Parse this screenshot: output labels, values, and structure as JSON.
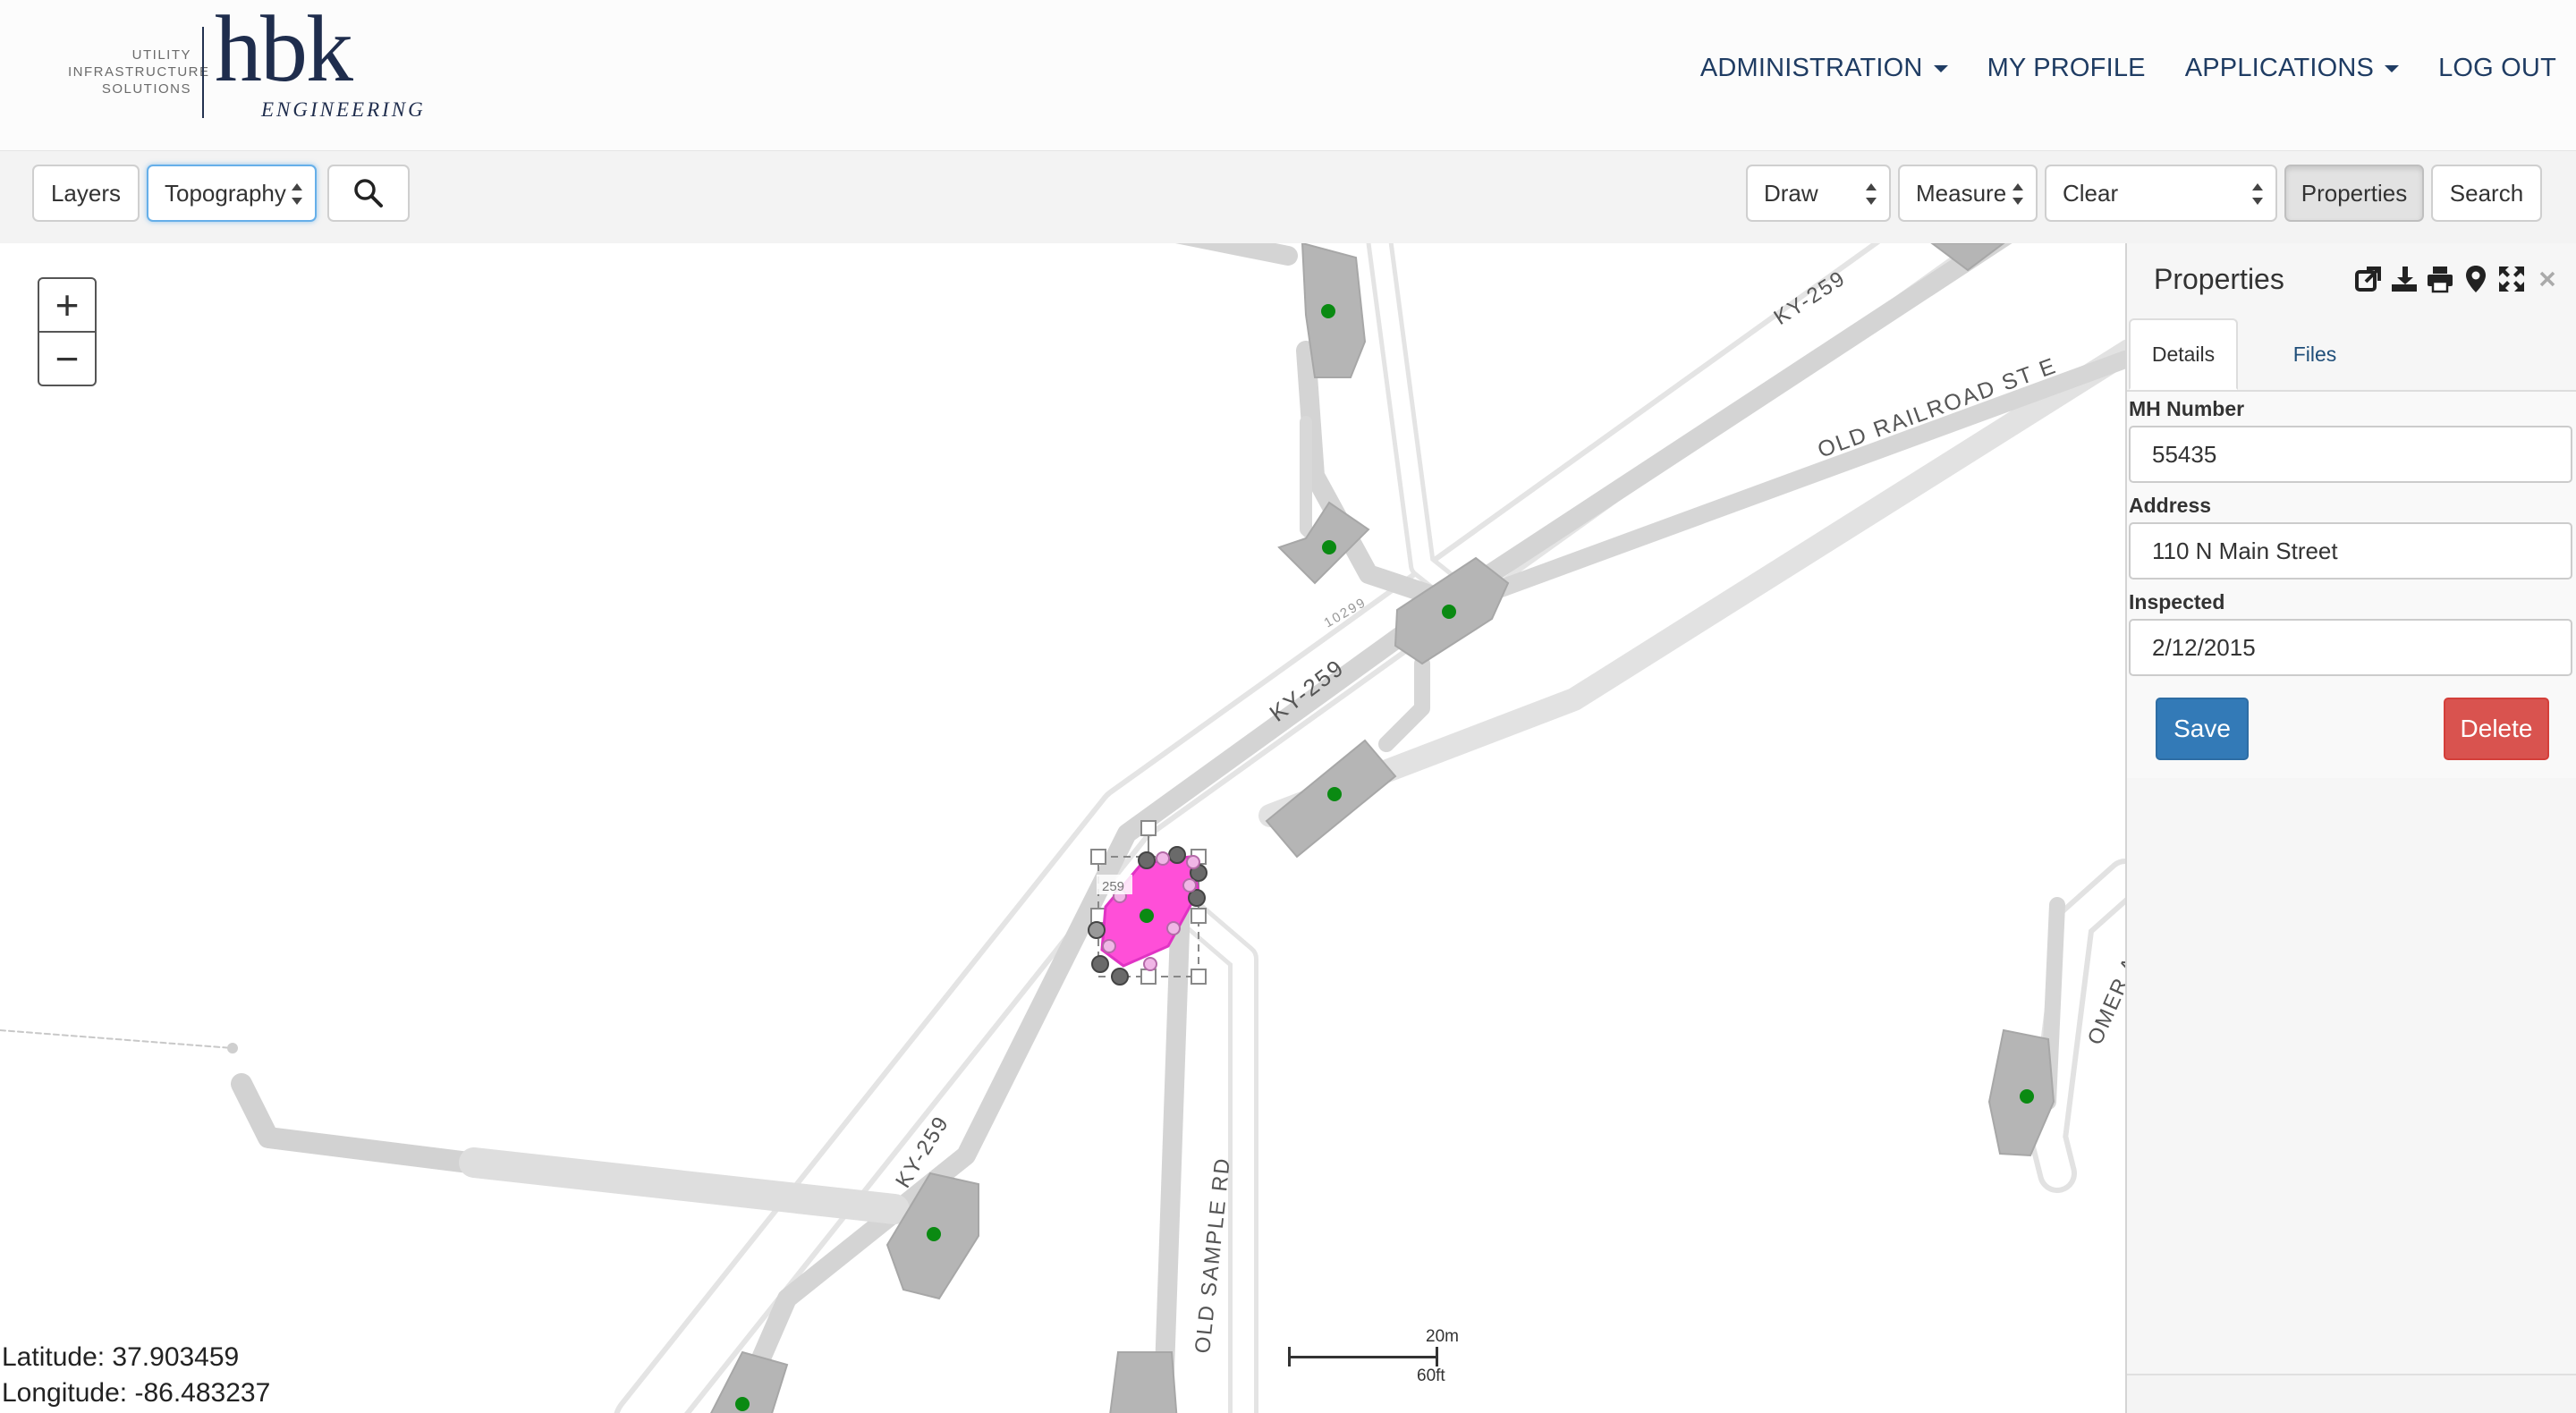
{
  "brand": {
    "tagline": [
      "UTILITY",
      "INFRASTRUCTURE",
      "SOLUTIONS"
    ],
    "name": "hbk",
    "subtitle": "ENGINEERING",
    "color": "#1f2d4d"
  },
  "nav": {
    "items": [
      {
        "label": "ADMINISTRATION",
        "dropdown": true
      },
      {
        "label": "MY PROFILE",
        "dropdown": false
      },
      {
        "label": "APPLICATIONS",
        "dropdown": true
      },
      {
        "label": "LOG OUT",
        "dropdown": false
      }
    ]
  },
  "toolbar": {
    "layers_label": "Layers",
    "basemap_value": "Topography",
    "search_icon": "search-icon",
    "draw_value": "Draw",
    "measure_value": "Measure",
    "clear_value": "Clear",
    "properties_label": "Properties",
    "search_label": "Search"
  },
  "map": {
    "zoom_in": "+",
    "zoom_out": "−",
    "road_labels": [
      "KY-259",
      "KY-259",
      "KY-259",
      "OLD RAILROAD ST E",
      "OLD SAMPLE RD",
      "OMER AP",
      "10299",
      "259"
    ],
    "latitude": "Latitude: 37.903459",
    "longitude": "Longitude: -86.483237",
    "scale_top": "20m",
    "scale_bottom": "60ft",
    "colors": {
      "road_fill": "#d4d4d4",
      "road_edge": "#bdbdbd",
      "building": "#b5b5b5",
      "point": "#0a8a12",
      "selected": "#ff4fd8"
    }
  },
  "panel": {
    "title": "Properties",
    "tool_icons": [
      "external-link-icon",
      "download-icon",
      "print-icon",
      "map-marker-icon",
      "expand-icon",
      "close-icon"
    ],
    "tabs": [
      "Details",
      "Files"
    ],
    "fields": {
      "mh_label": "MH Number",
      "mh_value": "55435",
      "address_label": "Address",
      "address_value": "110 N Main Street",
      "inspected_label": "Inspected",
      "inspected_value": "2/12/2015"
    },
    "save_label": "Save",
    "delete_label": "Delete",
    "save_color": "#337ab7",
    "delete_color": "#d9534f"
  }
}
